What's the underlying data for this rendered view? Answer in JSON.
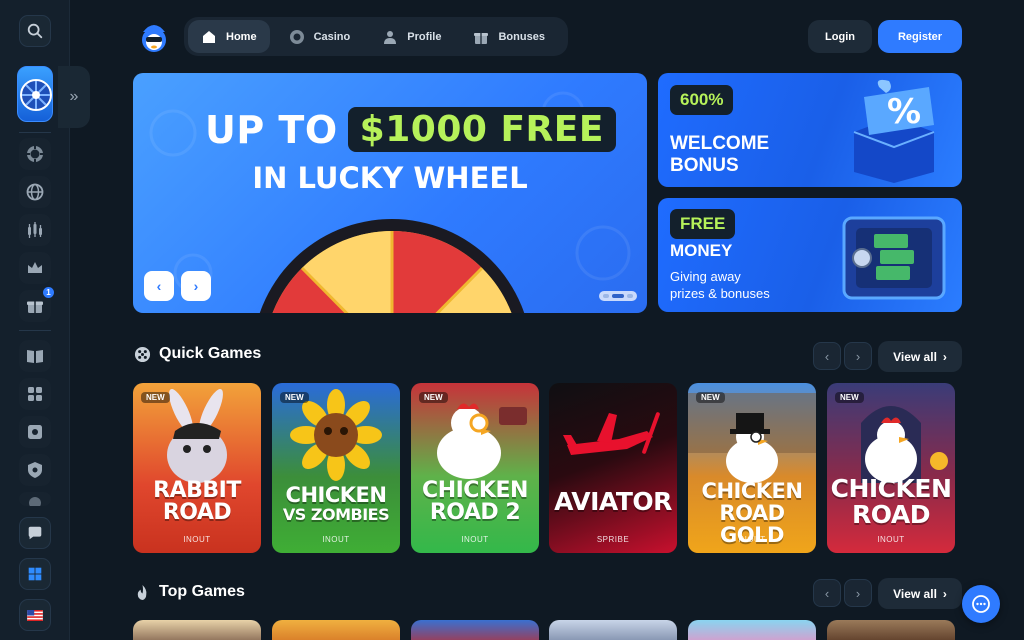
{
  "nav": {
    "items": [
      {
        "label": "Home",
        "icon": "home-icon",
        "active": true
      },
      {
        "label": "Casino",
        "icon": "chip-icon",
        "active": false
      },
      {
        "label": "Profile",
        "icon": "user-icon",
        "active": false
      },
      {
        "label": "Bonuses",
        "icon": "gift-icon",
        "active": false
      }
    ]
  },
  "auth": {
    "login": "Login",
    "register": "Register"
  },
  "sidebar": {
    "badge_count": "1",
    "icons": [
      "search-icon",
      "lucky-wheel",
      "chip-icon",
      "globe-icon",
      "chart-icon",
      "crown-icon",
      "gift-icon",
      "book-icon",
      "puzzle-icon",
      "safe-icon",
      "shield-icon",
      "chat-icon",
      "windows-icon",
      "flag-us-icon"
    ]
  },
  "hero": {
    "line1_prefix": "UP TO",
    "line1_highlight": "$1000 FREE",
    "line2": "IN LUCKY WHEEL",
    "prev": "‹",
    "next": "›"
  },
  "promos": [
    {
      "tag": "600%",
      "title_line1": "WELCOME",
      "title_line2": "BONUS"
    },
    {
      "tag": "FREE",
      "title_line1": "MONEY",
      "sub_line1": "Giving away",
      "sub_line2": "prizes & bonuses"
    }
  ],
  "sections": {
    "quick_games": {
      "title": "Quick Games",
      "view_all": "View all"
    },
    "top_games": {
      "title": "Top Games",
      "view_all": "View all"
    }
  },
  "games": [
    {
      "line1": "RABBIT",
      "line2": "ROAD",
      "provider": "INOUT",
      "new": "NEW",
      "color": "#e0472d"
    },
    {
      "line1": "CHICKEN",
      "line2": "VS ZOMBIES",
      "provider": "INOUT",
      "new": "NEW",
      "color": "#3fae35"
    },
    {
      "line1": "CHICKEN",
      "line2": "ROAD 2",
      "provider": "INOUT",
      "new": "NEW",
      "color": "#33b84a"
    },
    {
      "line1": "AVIATOR",
      "line2": "",
      "provider": "SPRIBE",
      "new": "",
      "color": "#c8102e"
    },
    {
      "line1": "CHICKEN",
      "line2": "ROAD GOLD",
      "provider": "INOUT",
      "new": "NEW",
      "color": "#f0a51a"
    },
    {
      "line1": "CHICKEN",
      "line2": "ROAD",
      "provider": "INOUT",
      "new": "NEW",
      "color": "#d42a3c"
    }
  ]
}
